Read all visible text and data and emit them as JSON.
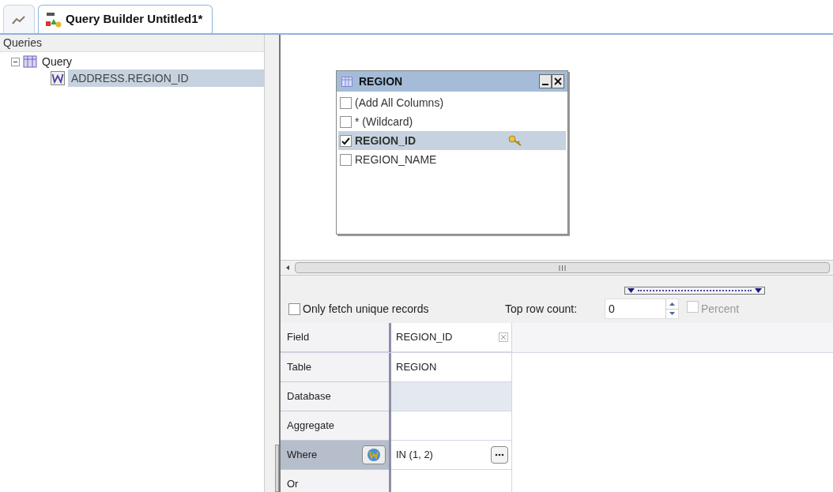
{
  "tabs": [
    {
      "kind": "chart",
      "selected": false
    },
    {
      "kind": "query",
      "label": "Query Builder Untitled1*",
      "selected": true
    }
  ],
  "queries_panel": {
    "title": "Queries",
    "tree": [
      {
        "label": "Query",
        "expanded": true,
        "children": [
          {
            "label": "ADDRESS.REGION_ID",
            "selected": true
          }
        ]
      }
    ]
  },
  "table_window": {
    "title": "REGION",
    "columns": [
      {
        "label": "(Add All Columns)",
        "checked": false,
        "selected": false,
        "primary_key": false
      },
      {
        "label": "* (Wildcard)",
        "checked": false,
        "selected": false,
        "primary_key": false
      },
      {
        "label": "REGION_ID",
        "checked": true,
        "selected": true,
        "primary_key": true
      },
      {
        "label": "REGION_NAME",
        "checked": false,
        "selected": false,
        "primary_key": false
      }
    ]
  },
  "options": {
    "unique_records": {
      "label": "Only fetch unique records",
      "checked": false
    },
    "top_row_count": {
      "label": "Top row count:",
      "value": "0"
    },
    "percent": {
      "label": "Percent",
      "checked": false,
      "disabled": true
    }
  },
  "grid": {
    "rows": [
      {
        "kind": "field",
        "label": "Field",
        "value": "REGION_ID",
        "selected": false,
        "shaded": false
      },
      {
        "kind": "text",
        "label": "Table",
        "value": "REGION",
        "selected": false,
        "shaded": false
      },
      {
        "kind": "text",
        "label": "Database",
        "selected": false,
        "shaded": true
      },
      {
        "kind": "text",
        "label": "Aggregate",
        "selected": false,
        "shaded": false
      },
      {
        "kind": "condition",
        "label": "Where",
        "value": "IN (1, 2)",
        "selected": true,
        "shaded": false
      },
      {
        "kind": "text",
        "label": "Or",
        "selected": false,
        "shaded": false
      }
    ]
  }
}
